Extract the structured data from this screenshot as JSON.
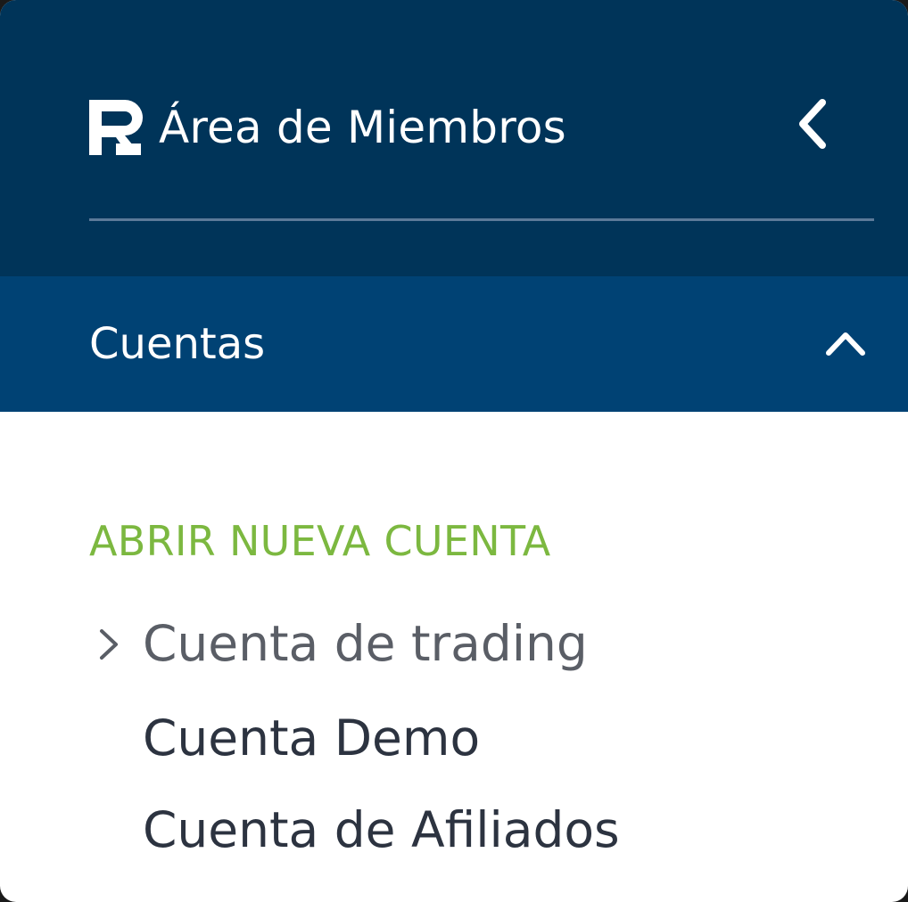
{
  "header": {
    "title": "Área de Miembros",
    "logo_icon": "roboforex-r-logo-icon",
    "back_icon": "chevron-left-icon"
  },
  "section": {
    "label": "Cuentas",
    "toggle_icon": "chevron-up-icon",
    "expanded": true
  },
  "submenu": {
    "group_label": "ABRIR NUEVA CUENTA",
    "items": [
      {
        "label": "Cuenta de trading",
        "active": true,
        "icon": "chevron-right-icon"
      },
      {
        "label": "Cuenta Demo",
        "active": false
      },
      {
        "label": "Cuenta de Afiliados",
        "active": false
      }
    ]
  },
  "colors": {
    "header_bg": "#003459",
    "section_bg": "#004274",
    "accent_green": "#7cb840",
    "text_dark": "#2c3340",
    "text_active": "#5a5e66"
  }
}
